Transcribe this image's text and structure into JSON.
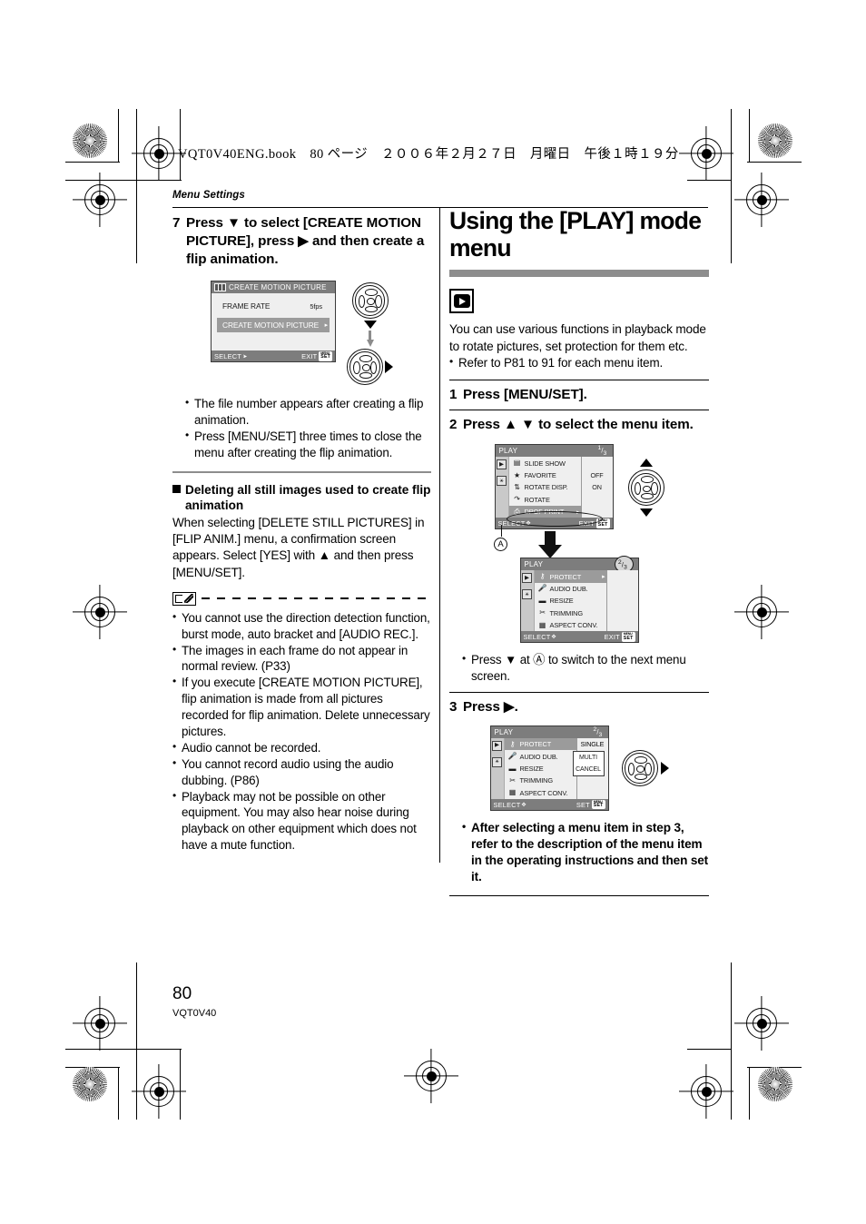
{
  "print_marks": {
    "header_line": "VQT0V40ENG.book　80 ページ　２００６年２月２７日　月曜日　午後１時１９分"
  },
  "page": {
    "running_head": "Menu Settings",
    "folio": "80",
    "doc_code": "VQT0V40"
  },
  "left_column": {
    "step7": {
      "number": "7",
      "text": "Press ▼ to select [CREATE MOTION PICTURE], press ▶ and then create a flip animation."
    },
    "lcd_create": {
      "title": "CREATE MOTION PICTURE",
      "title_icon": "flip-anim-icon",
      "rows": [
        {
          "label": "FRAME RATE",
          "value": "5fps",
          "selected": false,
          "arrow": false
        },
        {
          "label": "CREATE MOTION PICTURE",
          "value": "",
          "selected": true,
          "arrow": true
        }
      ],
      "footer_left": "SELECT",
      "footer_left_icon": "updown-right-icon",
      "footer_right": "EXIT",
      "footer_right_chip": "MENU SET"
    },
    "notes_after_step7": [
      "The file number appears after creating a flip animation.",
      "Press [MENU/SET] three times to close the menu after creating the flip animation."
    ],
    "subsection": {
      "heading": "Deleting all still images used to create flip animation",
      "body": "When selecting [DELETE STILL PICTURES] in [FLIP ANIM.] menu, a confirmation screen appears. Select [YES] with ▲ and then press [MENU/SET]."
    },
    "note_block": {
      "icon": "note-pencil-icon",
      "items": [
        "You cannot use the direction detection function, burst mode, auto bracket and [AUDIO REC.].",
        "The images in each frame do not appear in normal review. (P33)",
        "If you execute [CREATE MOTION PICTURE], flip animation is made from all pictures recorded for flip animation. Delete unnecessary pictures.",
        "Audio cannot be recorded.",
        "You cannot record audio using the audio dubbing. (P86)",
        "Playback may not be possible on other equipment. You may also hear noise during playback on other equipment which does not have a mute function."
      ]
    }
  },
  "right_column": {
    "title": "Using the [PLAY] mode menu",
    "badge_icon": "play-mode-icon",
    "intro": "You can use various functions in playback mode to rotate pictures, set protection for them etc.",
    "intro_bullets": [
      "Refer to P81 to 91 for each menu item."
    ],
    "step1": {
      "number": "1",
      "text": "Press [MENU/SET]."
    },
    "step2": {
      "number": "2",
      "text": "Press ▲ ▼ to select the menu item."
    },
    "step3": {
      "number": "3",
      "text": "Press ▶."
    },
    "callout_a": "A",
    "note_switch": "Press ▼ at Ⓐ to switch to the next menu screen.",
    "final_note": "After selecting a menu item in step 3, refer to the description of the menu item in the operating instructions and then set it.",
    "lcd_play1": {
      "title": "PLAY",
      "page": "1/3",
      "page_num": "1",
      "page_den": "3",
      "tabs": [
        "play-tab-icon",
        "setup-tab-icon"
      ],
      "rows": [
        {
          "icon": "slideshow-icon",
          "label": "SLIDE SHOW",
          "value": "",
          "selected": false,
          "arrow": false
        },
        {
          "icon": "star-icon",
          "label": "FAVORITE",
          "value": "OFF",
          "selected": false,
          "arrow": false
        },
        {
          "icon": "rotate-disp-icon",
          "label": "ROTATE DISP.",
          "value": "ON",
          "selected": false,
          "arrow": false
        },
        {
          "icon": "rotate-icon",
          "label": "ROTATE",
          "value": "",
          "selected": false,
          "arrow": false
        },
        {
          "icon": "dpof-icon",
          "label": "DPOF PRINT",
          "value": "",
          "selected": true,
          "arrow": true
        }
      ],
      "footer_left": "SELECT",
      "footer_right": "EXIT",
      "footer_right_chip": "MENU SET"
    },
    "lcd_play2": {
      "title": "PLAY",
      "page": "2/3",
      "page_num": "2",
      "page_den": "3",
      "page_circled": true,
      "rows": [
        {
          "icon": "key-icon",
          "label": "PROTECT",
          "value": "",
          "selected": true,
          "arrow": true
        },
        {
          "icon": "mic-icon",
          "label": "AUDIO DUB.",
          "value": "",
          "selected": false,
          "arrow": false
        },
        {
          "icon": "resize-icon",
          "label": "RESIZE",
          "value": "",
          "selected": false,
          "arrow": false
        },
        {
          "icon": "trimming-icon",
          "label": "TRIMMING",
          "value": "",
          "selected": false,
          "arrow": false
        },
        {
          "icon": "aspect-conv-icon",
          "label": "ASPECT CONV.",
          "value": "",
          "selected": false,
          "arrow": false
        }
      ],
      "footer_left": "SELECT",
      "footer_right": "EXIT",
      "footer_right_chip": "MENU SET"
    },
    "lcd_play3": {
      "title": "PLAY",
      "page": "2/3",
      "page_num": "2",
      "page_den": "3",
      "rows": [
        {
          "icon": "key-icon",
          "label": "PROTECT",
          "value": "SINGLE",
          "selected": true,
          "arrow": false
        },
        {
          "icon": "mic-icon",
          "label": "AUDIO DUB.",
          "value": "",
          "selected": false,
          "arrow": false
        },
        {
          "icon": "resize-icon",
          "label": "RESIZE",
          "value": "",
          "selected": false,
          "arrow": false
        },
        {
          "icon": "trimming-icon",
          "label": "TRIMMING",
          "value": "",
          "selected": false,
          "arrow": false
        },
        {
          "icon": "aspect-conv-icon",
          "label": "ASPECT CONV.",
          "value": "",
          "selected": false,
          "arrow": false
        }
      ],
      "popup": [
        "MULTI",
        "CANCEL"
      ],
      "footer_left": "SELECT",
      "footer_right": "SET",
      "footer_right_chip": "MENU SET"
    }
  }
}
